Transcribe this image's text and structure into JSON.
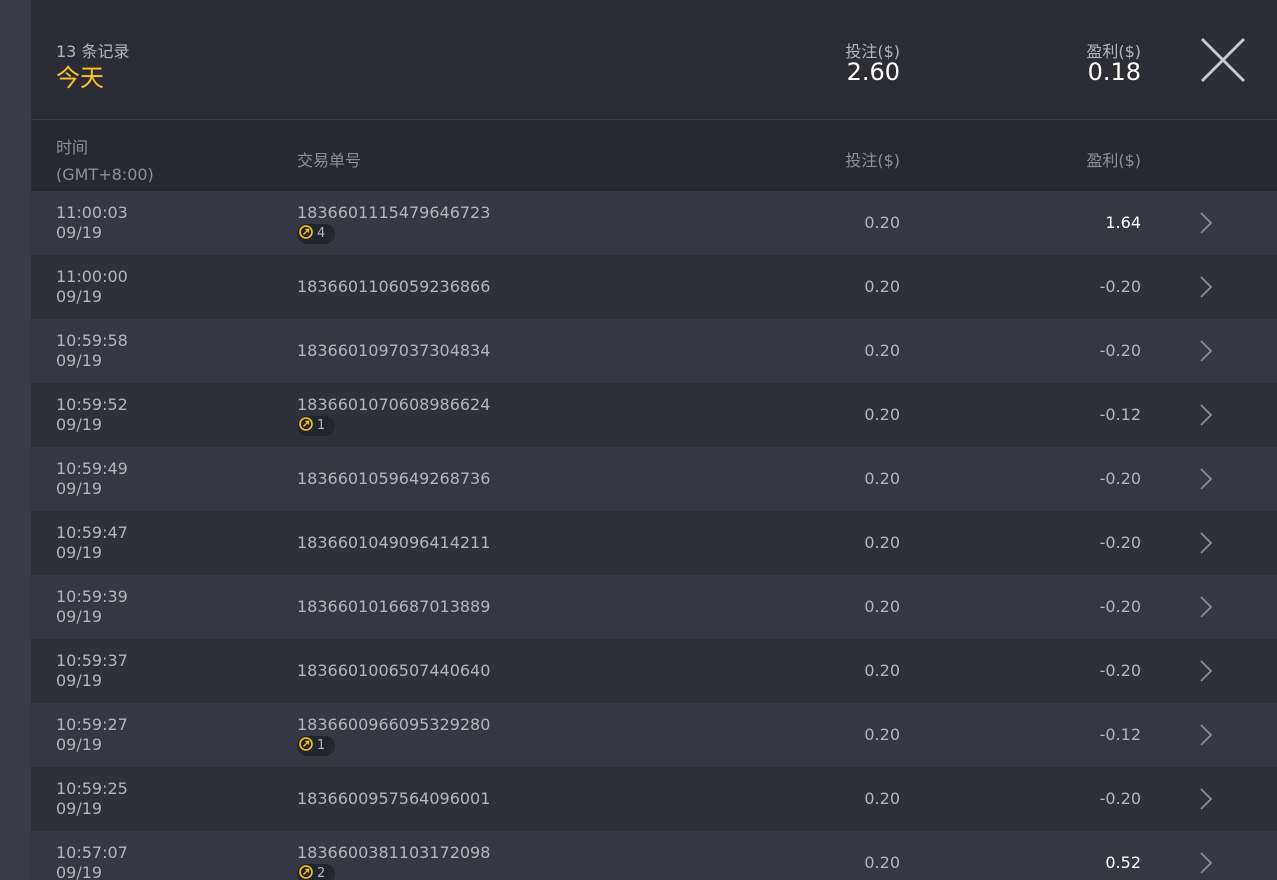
{
  "summary": {
    "record_count": "13 条记录",
    "period": "今天",
    "bet_label": "投注($)",
    "bet_total": "2.60",
    "profit_label": "盈利($)",
    "profit_total": "0.18"
  },
  "table": {
    "headers": {
      "time": "时间",
      "timezone": "(GMT+8:00)",
      "order": "交易单号",
      "bet": "投注($)",
      "profit": "盈利($)"
    },
    "rows": [
      {
        "time": "11:00:03",
        "date": "09/19",
        "order": "1836601115479646723",
        "free_spins": "4",
        "bet": "0.20",
        "profit": "1.64",
        "win": true
      },
      {
        "time": "11:00:00",
        "date": "09/19",
        "order": "1836601106059236866",
        "free_spins": "",
        "bet": "0.20",
        "profit": "-0.20",
        "win": false
      },
      {
        "time": "10:59:58",
        "date": "09/19",
        "order": "1836601097037304834",
        "free_spins": "",
        "bet": "0.20",
        "profit": "-0.20",
        "win": false
      },
      {
        "time": "10:59:52",
        "date": "09/19",
        "order": "1836601070608986624",
        "free_spins": "1",
        "bet": "0.20",
        "profit": "-0.12",
        "win": false
      },
      {
        "time": "10:59:49",
        "date": "09/19",
        "order": "1836601059649268736",
        "free_spins": "",
        "bet": "0.20",
        "profit": "-0.20",
        "win": false
      },
      {
        "time": "10:59:47",
        "date": "09/19",
        "order": "1836601049096414211",
        "free_spins": "",
        "bet": "0.20",
        "profit": "-0.20",
        "win": false
      },
      {
        "time": "10:59:39",
        "date": "09/19",
        "order": "1836601016687013889",
        "free_spins": "",
        "bet": "0.20",
        "profit": "-0.20",
        "win": false
      },
      {
        "time": "10:59:37",
        "date": "09/19",
        "order": "1836601006507440640",
        "free_spins": "",
        "bet": "0.20",
        "profit": "-0.20",
        "win": false
      },
      {
        "time": "10:59:27",
        "date": "09/19",
        "order": "1836600966095329280",
        "free_spins": "1",
        "bet": "0.20",
        "profit": "-0.12",
        "win": false
      },
      {
        "time": "10:59:25",
        "date": "09/19",
        "order": "1836600957564096001",
        "free_spins": "",
        "bet": "0.20",
        "profit": "-0.20",
        "win": false
      },
      {
        "time": "10:57:07",
        "date": "09/19",
        "order": "1836600381103172098",
        "free_spins": "2",
        "bet": "0.20",
        "profit": "0.52",
        "win": true
      }
    ]
  },
  "icons": {
    "close": "close-icon",
    "row_arrow": "chevron-right-icon",
    "free_spin": "free-spin-coin-icon"
  },
  "colors": {
    "accent": "#f7c325",
    "background": "#30313b",
    "row_alt": "#363743",
    "header_bg": "#282832",
    "text_muted": "#b4b4bd",
    "win_text": "#ffffff"
  }
}
